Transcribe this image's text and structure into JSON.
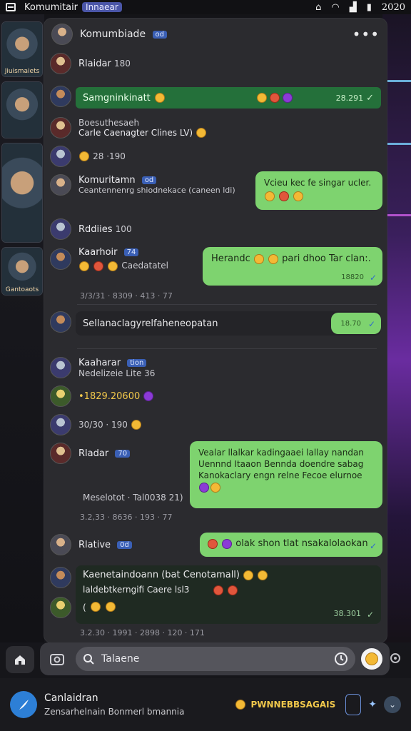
{
  "status_bar": {
    "app_name": "Komumitair",
    "badge": "Innaear",
    "time": "2020"
  },
  "side_cards": [
    {
      "caption": "Jiuismaiets"
    },
    {
      "caption": "Gantoaots"
    }
  ],
  "chat": {
    "header": {
      "title": "Komumbiade",
      "tag": "od",
      "more": "•••"
    },
    "rows": {
      "r1": {
        "name": "Rlaidar",
        "count": "180"
      },
      "r2": {
        "text": "Samgninkinatt",
        "time": "28.291"
      },
      "r3": {
        "name": "Boesuthesaeh",
        "sub": "Carle Caenagter Clines LV)"
      },
      "r4": {
        "count": "28 ·190"
      },
      "r5": {
        "name": "Komuritamn",
        "tag": "od",
        "sub": "Ceantennenrg shiodnekace (caneen ldi)"
      },
      "r5_bubble": {
        "text": "Vcieu kec fe singar ucler."
      },
      "r6": {
        "name": "Rddiies",
        "count": "100"
      },
      "r7": {
        "name": "Kaarhoir",
        "tag": "74",
        "sub": "Caedatatel"
      },
      "r7_bubble": {
        "text": "Herandc",
        "text2": "pari dhoo Tar clan:.",
        "time": "18820"
      },
      "r7_meta": "3/3/31 · 8309 · 413 · 77",
      "r8": {
        "text": "Sellanaclagyrelfaheneopatan"
      },
      "r8_bubble": {
        "time": "18.70"
      },
      "r9": {
        "name": "Kaaharar",
        "tag": "tion",
        "sub": "Nedelizeie Lite 36"
      },
      "r10": {
        "text": "•1829.20600"
      },
      "r11": {
        "text": "30/30 · 190"
      },
      "r12": {
        "name": "Rladar",
        "tag": "70",
        "sub": "Meselotot · Tal0038 21)"
      },
      "r12_bubble": {
        "line1": "Vealar llalkar kadingaaei lallay nandan",
        "line2": "Uennnd Itaaon Bennda doendre sabag",
        "line3": "Kanokaclary engn relne Fecoe elurnoe"
      },
      "r12_meta": "3.2,33 · 8636 · 193 · 77",
      "r13": {
        "name": "Rlative",
        "tag": "0d"
      },
      "r13_bubble": {
        "text": "olak shon tlat nsakalolaokan"
      },
      "r14": {
        "name": "Kaenetaindoann",
        "sub": "(bat Cenotamall)"
      },
      "r15": {
        "text": "laldebtkerngifi Caere lsl3",
        "time": "38.301"
      },
      "footer_meta": "3.2.30 · 1991 · 2898 · 120 · 171"
    }
  },
  "search": {
    "placeholder": "Talaene"
  },
  "bottom_bar": {
    "title": "Canlaidran",
    "subtitle": "Zensarhelnain Bonmerl bmannia",
    "promo": "PWNNEBBSAGAIS"
  },
  "colors": {
    "bubble_green": "#7ed36f",
    "strip_green": "#24703a",
    "panel": "#2b2b2f",
    "accent_blue": "#3a5fb5"
  }
}
